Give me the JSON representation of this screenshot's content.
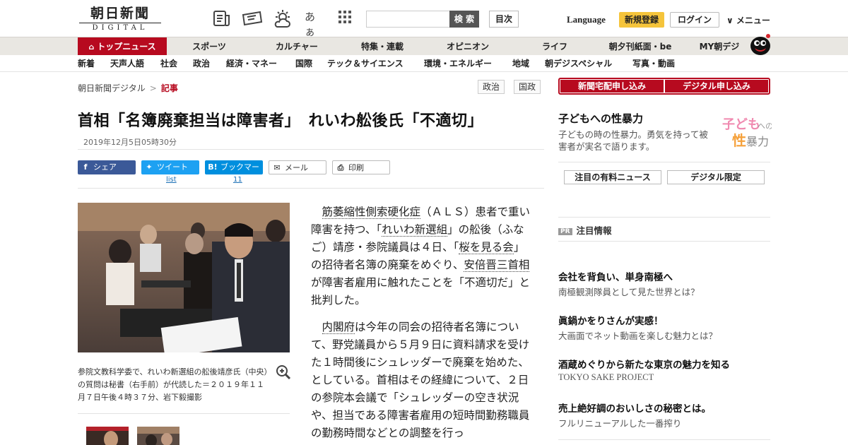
{
  "header": {
    "logo_main": "朝日新聞",
    "logo_sub": "DIGITAL",
    "search_button": "検 索",
    "search_placeholder": "",
    "toc_button": "目次",
    "language": "Language",
    "register": "新規登録",
    "login": "ログイン",
    "menu": "∨ メニュー",
    "icon_kana": "あぁ"
  },
  "nav_primary": [
    "トップニュース",
    "スポーツ",
    "カルチャー",
    "特集・連載",
    "オピニオン",
    "ライフ",
    "朝夕刊紙面・be",
    "MY朝デジ"
  ],
  "nav_secondary": [
    "新着",
    "天声人語",
    "社会",
    "政治",
    "経済・マネー",
    "国際",
    "テック＆サイエンス",
    "環境・エネルギー",
    "地域",
    "朝デジスペシャル",
    "写真・動画"
  ],
  "breadcrumb": {
    "home": "朝日新聞デジタル",
    "sep": ">",
    "current": "記事"
  },
  "tags": [
    "政治",
    "国政"
  ],
  "article": {
    "title": "首相「名簿廃棄担当は障害者」　れいわ舩後氏「不適切」",
    "date": "2019年12月5日05時30分",
    "caption": "参院文教科学委で、れいわ新選組の舩後靖彦氏（中央）の質問は秘書（右手前）が代読した＝２０１９年１１月７日午後４時３７分、岩下毅撮影",
    "paragraphs": [
      [
        {
          "t": "筋萎縮性側索硬化症",
          "link": true
        },
        {
          "t": "（ＡＬＳ）患者で重い障害を持つ、「"
        },
        {
          "t": "れいわ新選組",
          "link": true
        },
        {
          "t": "」の舩後（ふなご）靖彦・参院議員は４日、「"
        },
        {
          "t": "桜を見る会",
          "link": true
        },
        {
          "t": "」の招待者名簿の廃棄をめぐり、"
        },
        {
          "t": "安倍晋三首相",
          "link": true
        },
        {
          "t": "が障害者雇用に触れたことを「不適切だ」と批判した。"
        }
      ],
      [
        {
          "t": "内閣府",
          "link": true
        },
        {
          "t": "は今年の同会の招待者名簿について、野党議員から５月９日に資料請求を受けた１時間後にシュレッダーで廃棄を始めた、としている。首相はその経緯について、２日の参院本会議で「シュレッダーの空き状況や、担当である障害者雇用の短時間勤務職員の勤務時間などとの調整を行っ"
        }
      ]
    ]
  },
  "share": {
    "facebook": "シェア",
    "twitter": "ツイート",
    "twitter_count": "list",
    "hatena_icon": "B!",
    "hatena": "ブックマーク",
    "hatena_count": "11",
    "mail": "メール",
    "print": "印刷"
  },
  "sidebar": {
    "subscribe_paper": "新聞宅配申し込み",
    "subscribe_digital": "デジタル申し込み",
    "feature_title": "子どもへの性暴力",
    "feature_desc": "子どもの時の性暴力。勇気を持って被害者が実名で語ります。",
    "feature_image_text": [
      "子ども",
      "への",
      "性",
      "暴力"
    ],
    "tab_paid": "注目の有料ニュース",
    "tab_digital": "デジタル限定",
    "pr_badge": "PR",
    "pr_heading": "注目情報",
    "pr_items": [
      {
        "title": "会社を背負い、単身南極へ",
        "sub": "南極観測隊員として見た世界とは？"
      },
      {
        "title": "眞鍋かをりさんが実感！",
        "sub": "大画面でネット動画を楽しむ魅力とは？"
      },
      {
        "title": "酒蔵めぐりから新たな東京の魅力を知る",
        "sub": "TOKYO SAKE PROJECT"
      },
      {
        "title": "売上絶好調のおいしさの秘密とは。",
        "sub": "フルリニューアルした一番搾り"
      }
    ]
  },
  "colors": {
    "brand_red": "#b70a1f",
    "register_yellow": "#f5c43b",
    "facebook": "#3b5998",
    "twitter": "#1da1f2",
    "hatena": "#008fde"
  }
}
